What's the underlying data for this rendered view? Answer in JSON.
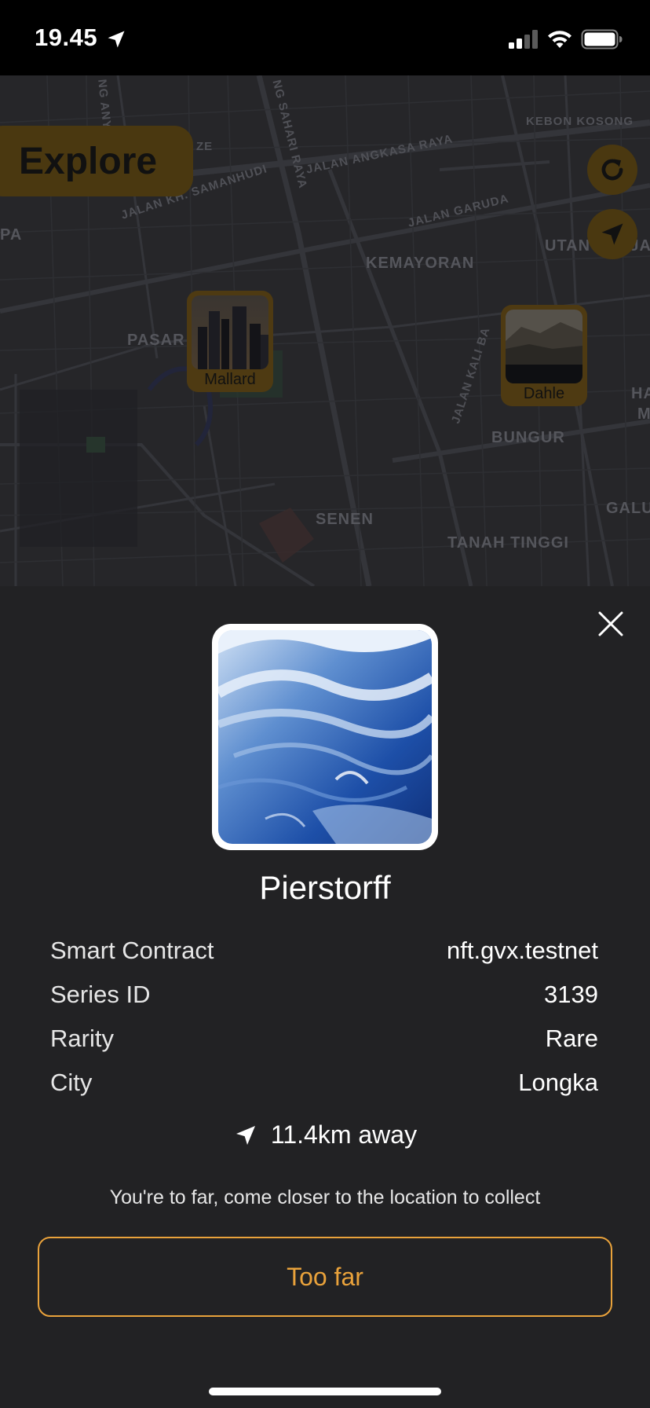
{
  "status_bar": {
    "time": "19.45",
    "icons": [
      "location-arrow-icon",
      "cellular-signal-icon",
      "wifi-icon",
      "battery-icon"
    ]
  },
  "map": {
    "street_labels": [
      "KEBON KOSONG",
      "JALAN ANGKASA RAYA",
      "JALAN KH. SAMANHUDI",
      "JALAN GARUDA",
      "UTAN PANJAN",
      "KEMAYORAN",
      "PASAR",
      "BUNGUR",
      "SENEN",
      "TANAH TINGGI",
      "GALU",
      "HA",
      "M",
      "PA",
      "ZE",
      "JALAN KALI BA",
      "NG ANY",
      "NG SAHARI RAYA"
    ],
    "explore_label": "Explore",
    "refresh_icon": "refresh-icon",
    "locate_icon": "navigation-arrow-icon",
    "markers": [
      {
        "label": "Mallard",
        "image": "city-skyline"
      },
      {
        "label": "Dahle",
        "image": "coastal-cliffs"
      }
    ]
  },
  "sheet": {
    "close_icon": "close-icon",
    "title": "Pierstorff",
    "details": [
      {
        "key": "Smart Contract",
        "value": "nft.gvx.testnet"
      },
      {
        "key": "Series ID",
        "value": "3139"
      },
      {
        "key": "Rarity",
        "value": "Rare"
      },
      {
        "key": "City",
        "value": "Longka"
      }
    ],
    "distance": "11.4km away",
    "hint": "You're to far, come closer to the location to collect",
    "action_label": "Too far",
    "colors": {
      "accent": "#e9a23b",
      "sheet_bg": "#222224",
      "map_bg": "#262629"
    }
  }
}
